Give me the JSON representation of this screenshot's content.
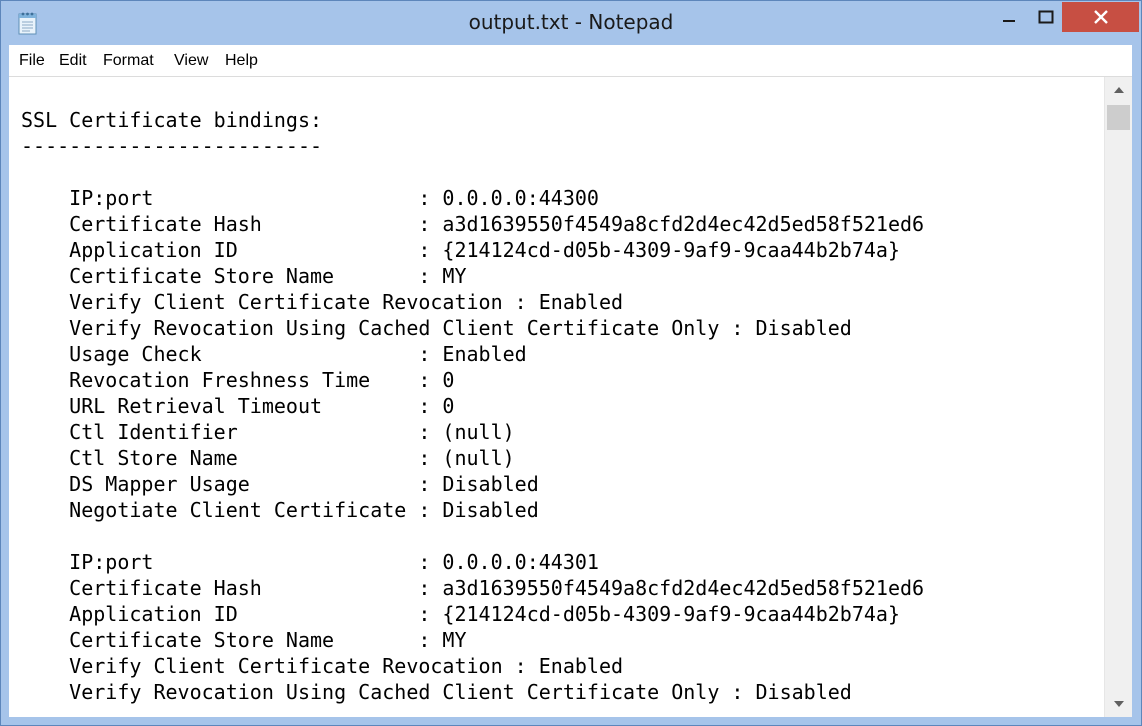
{
  "window": {
    "title": "output.txt - Notepad"
  },
  "menu": [
    "File",
    "Edit",
    "Format",
    "View",
    "Help"
  ],
  "document": {
    "lines": [
      "SSL Certificate bindings:",
      "-------------------------",
      "",
      "    IP:port                      : 0.0.0.0:44300",
      "    Certificate Hash             : a3d1639550f4549a8cfd2d4ec42d5ed58f521ed6",
      "    Application ID               : {214124cd-d05b-4309-9af9-9caa44b2b74a}",
      "    Certificate Store Name       : MY",
      "    Verify Client Certificate Revocation : Enabled",
      "    Verify Revocation Using Cached Client Certificate Only : Disabled",
      "    Usage Check                  : Enabled",
      "    Revocation Freshness Time    : 0",
      "    URL Retrieval Timeout        : 0",
      "    Ctl Identifier               : (null)",
      "    Ctl Store Name               : (null)",
      "    DS Mapper Usage              : Disabled",
      "    Negotiate Client Certificate : Disabled",
      "",
      "    IP:port                      : 0.0.0.0:44301",
      "    Certificate Hash             : a3d1639550f4549a8cfd2d4ec42d5ed58f521ed6",
      "    Application ID               : {214124cd-d05b-4309-9af9-9caa44b2b74a}",
      "    Certificate Store Name       : MY",
      "    Verify Client Certificate Revocation : Enabled",
      "    Verify Revocation Using Cached Client Certificate Only : Disabled"
    ]
  },
  "icons": {
    "app": "notepad-icon",
    "minimize": "minimize-icon",
    "maximize": "maximize-icon",
    "close": "close-icon",
    "scroll_up": "scroll-up-arrow-icon",
    "scroll_down": "scroll-down-arrow-icon"
  },
  "colors": {
    "titlebar": "#a6c4ea",
    "close_button": "#c74f43",
    "editor_background": "#ffffff"
  }
}
